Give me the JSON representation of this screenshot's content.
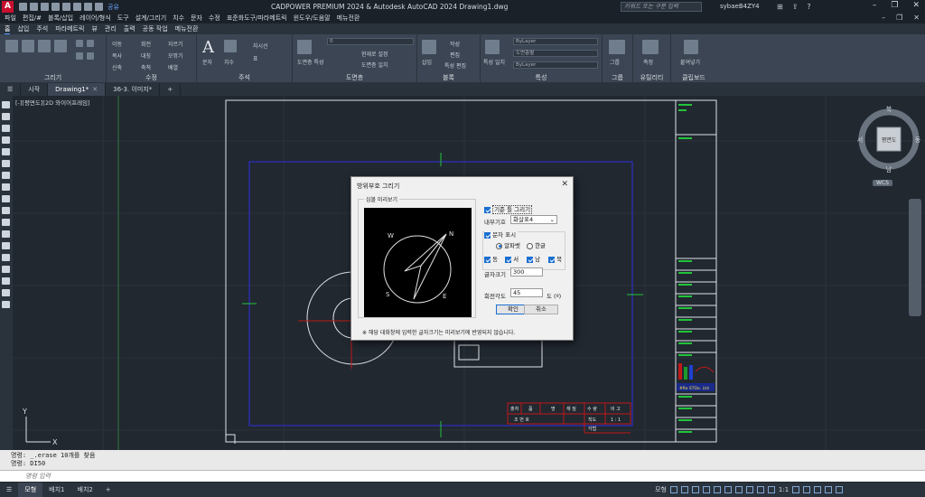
{
  "title": {
    "text": "CADPOWER PREMIUM 2024  & Autodesk AutoCAD 2024    Drawing1.dwg",
    "share": "공유",
    "search_placeholder": "키워드 또는 구문 입력",
    "user": "sybaeB4ZY4"
  },
  "menu": [
    "파일",
    "편집/#",
    "블록/삽입",
    "레이어/형식",
    "도구",
    "설계/그리기",
    "치수",
    "문자",
    "수정",
    "표준화도구/파라메트릭",
    "윈도우/도움말",
    "메뉴전환"
  ],
  "ribbon_tabs": [
    "홈",
    "삽입",
    "주석",
    "파라메트릭",
    "뷰",
    "관리",
    "출력",
    "공동 작업",
    "메뉴전환"
  ],
  "ribbon_panels": {
    "draw": "그리기",
    "modify": "수정",
    "annotation": "주석",
    "layers": "도면층",
    "block": "블록",
    "properties": "특성",
    "groups": "그룹",
    "utilities": "유틸리티",
    "clipboard": "클립보드",
    "modify_items": [
      "이동",
      "회전",
      "자르기",
      "복사",
      "대칭",
      "모깎기",
      "신축",
      "축척",
      "배열"
    ],
    "annotation_items": [
      "문자",
      "치수",
      "지시선",
      "표"
    ],
    "layer_value": "0",
    "layer_items": [
      "도면층 특성",
      "현재로 설정",
      "도면층 일치"
    ],
    "block_items": [
      "삽입",
      "작성",
      "편집",
      "특성 편집"
    ],
    "properties_items": [
      "특성 일치",
      "ByLayer",
      "도면층별",
      "ByLayer"
    ],
    "group_item": "그룹",
    "utility_item": "측정",
    "clipboard_item": "붙여넣기"
  },
  "doc_tabs": [
    "시작",
    "Drawing1*",
    "36-3. 이미지*"
  ],
  "viewport_label": "[-][평면도][2D 와이어프레임]",
  "viewcube": {
    "north": "북",
    "south": "남",
    "east": "동",
    "west": "서",
    "top": "평면도",
    "wcs": "WCS"
  },
  "titleblock": {
    "row1": [
      "출처",
      "품",
      "명",
      "재 질",
      "수 량",
      "비 고"
    ],
    "row2": [
      "조 번 호",
      "척도",
      "1 : 1"
    ],
    "row3": [
      "각법"
    ],
    "logo_text": "#Re STOo. Ltd"
  },
  "dialog": {
    "title": "방위부호 그리기",
    "preview_label": "심볼 미리보기",
    "preview_letters": {
      "n": "N",
      "e": "E",
      "s": "S",
      "w": "W"
    },
    "base_line_label": "기준 틀 그리기",
    "inner_symbol_label": "내부기호",
    "inner_symbol_value": "화살표4",
    "text_display_label": "문자 표시",
    "alphabet_label": "알파벳",
    "korean_label": "한글",
    "east_label": "동",
    "west_label": "서",
    "south_label": "남",
    "north_label": "북",
    "text_size_label": "글자크기",
    "text_size_value": "300",
    "rotation_label": "회전각도",
    "rotation_value": "45",
    "rotation_unit": "도 (º)",
    "ok_label": "확인",
    "cancel_label": "취소",
    "note": "※ 해당 대화창에 입력한 글자크기는 미리보기에 반영되지 않습니다."
  },
  "command": {
    "history1": "명령: _.erase 10개를 찾음",
    "history2": "명령: DI50",
    "placeholder": "명령 입력"
  },
  "layout_tabs": [
    "모형",
    "배치1",
    "배치2"
  ],
  "status": {
    "model": "모형",
    "scale": "1:1"
  }
}
